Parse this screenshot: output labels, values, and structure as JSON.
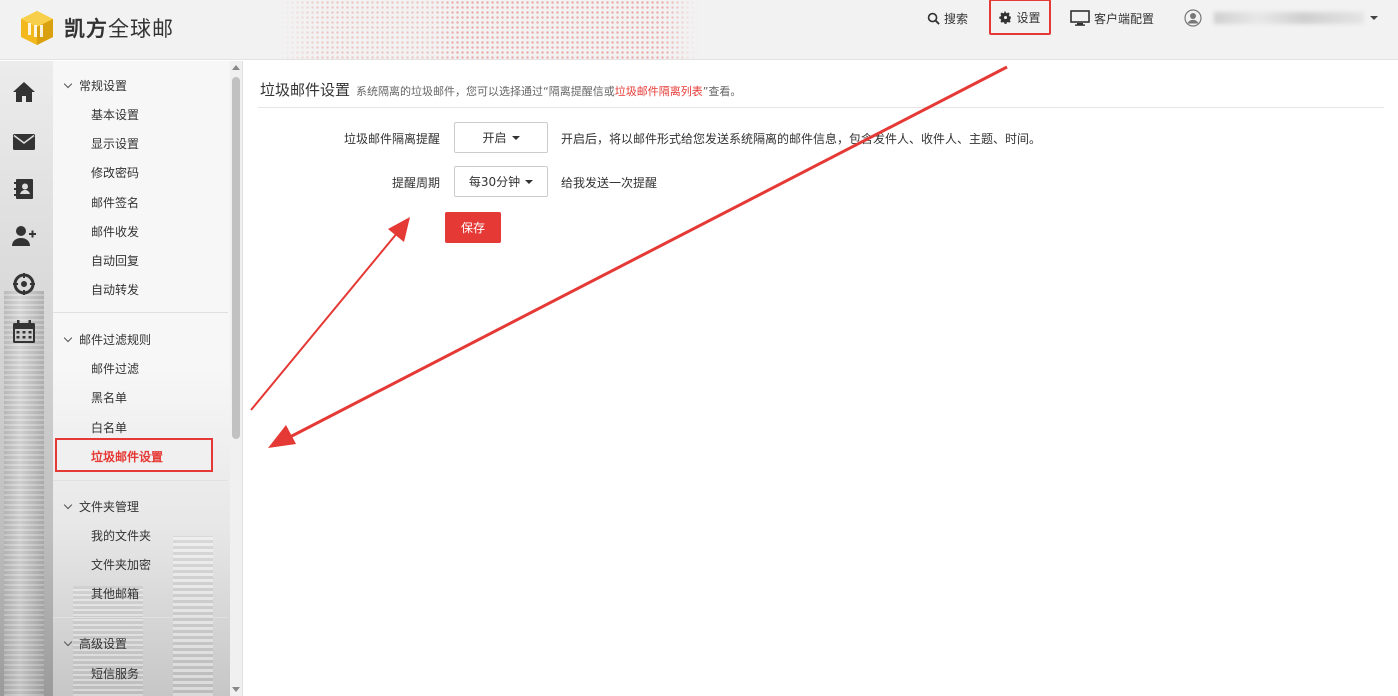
{
  "header": {
    "logo_bold": "凯方",
    "logo_rest": "全球邮",
    "search_label": "搜索",
    "settings_label": "设置",
    "client_label": "客户端配置"
  },
  "iconbar": {
    "icons": [
      "home-icon",
      "mail-icon",
      "contacts-icon",
      "add-user-icon",
      "compass-icon",
      "calendar-icon"
    ]
  },
  "sidebar": {
    "groups": [
      {
        "title": "常规设置",
        "items": [
          "基本设置",
          "显示设置",
          "修改密码",
          "邮件签名",
          "邮件收发",
          "自动回复",
          "自动转发"
        ]
      },
      {
        "title": "邮件过滤规则",
        "items": [
          "邮件过滤",
          "黑名单",
          "白名单",
          "垃圾邮件设置"
        ]
      },
      {
        "title": "文件夹管理",
        "items": [
          "我的文件夹",
          "文件夹加密",
          "其他邮箱"
        ]
      },
      {
        "title": "高级设置",
        "items": [
          "短信服务"
        ]
      }
    ],
    "active_item": "垃圾邮件设置"
  },
  "main": {
    "title": "垃圾邮件设置",
    "desc_prefix": "系统隔离的垃圾邮件，您可以选择通过“隔离提醒信或",
    "desc_link": "垃圾邮件隔离列表",
    "desc_suffix": "”查看。",
    "form": {
      "reminder_label": "垃圾邮件隔离提醒",
      "reminder_value": "开启",
      "reminder_hint": "开启后，将以邮件形式给您发送系统隔离的邮件信息，包含发件人、收件人、主题、时间。",
      "period_label": "提醒周期",
      "period_value": "每30分钟",
      "period_hint": "给我发送一次提醒",
      "save_label": "保存"
    }
  },
  "colors": {
    "accent": "#e53935",
    "annotation": "#e53935"
  }
}
